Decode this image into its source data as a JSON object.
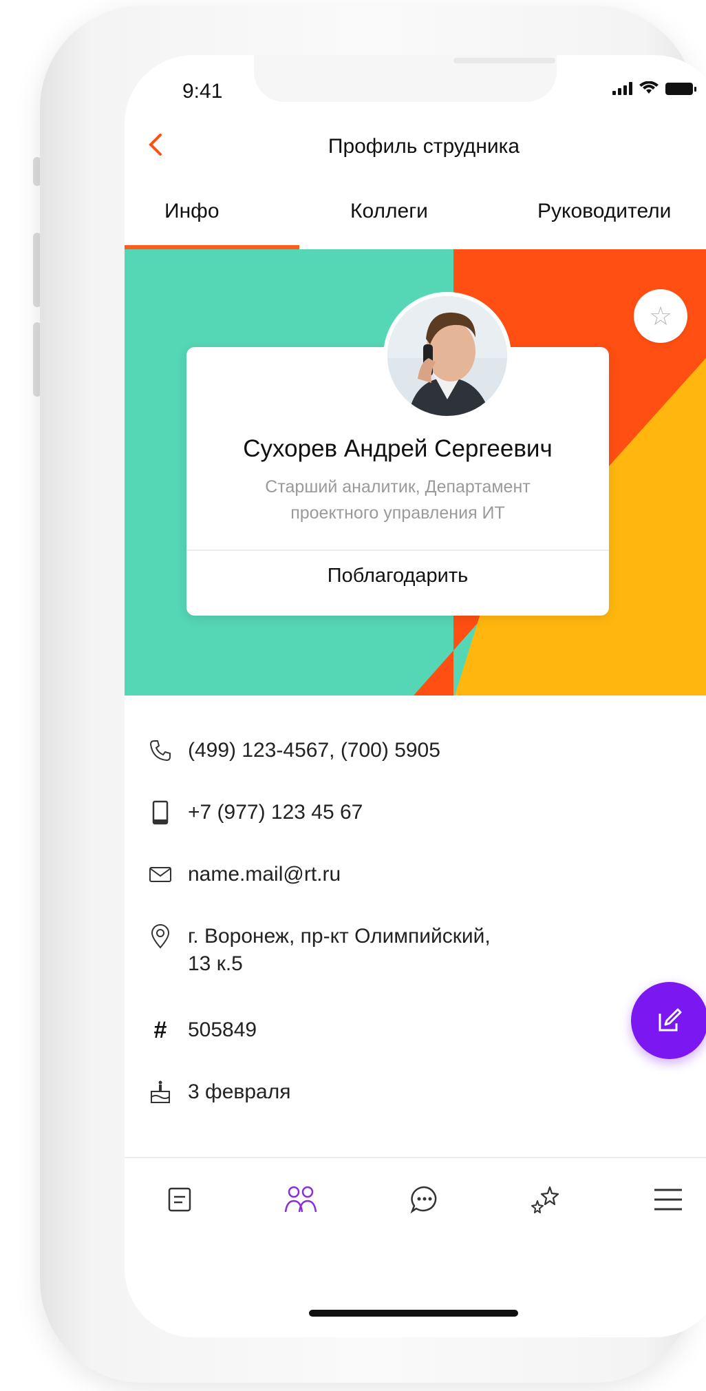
{
  "status_bar": {
    "time": "9:41"
  },
  "header": {
    "title": "Профиль струдника"
  },
  "tabs": [
    {
      "label": "Инфо",
      "active": true
    },
    {
      "label": "Коллеги",
      "active": false
    },
    {
      "label": "Руководители",
      "active": false
    }
  ],
  "colors": {
    "accent": "#ff5c1e",
    "banner_teal": "#55d6b4",
    "banner_orange": "#ff4f12",
    "banner_yellow": "#ffb70f",
    "fab_purple": "#7b18f2",
    "active_tab_icon": "#8a2be2"
  },
  "profile": {
    "name": "Сухорев Андрей Сергеевич",
    "position_line1": "Старший аналитик, Департамент",
    "position_line2": "проектного управления ИТ",
    "thank_label": "Поблагодарить",
    "favorite_icon": "star-icon"
  },
  "details": {
    "phones": "(499) 123-4567, (700) 5905",
    "mobile": "+7 (977) 123 45 67",
    "email": "name.mail@rt.ru",
    "address_line1": "г. Воронеж, пр-кт Олимпийский,",
    "address_line2": "13 к.5",
    "id": "505849",
    "birthday": "3 февраля"
  },
  "icons": {
    "phone": "phone-icon",
    "mobile": "mobile-icon",
    "mail": "mail-icon",
    "location": "location-icon",
    "hash": "hash-icon",
    "cake": "cake-icon",
    "fab": "edit-icon"
  },
  "tabbar": [
    {
      "icon": "news-icon",
      "active": false
    },
    {
      "icon": "people-icon",
      "active": true
    },
    {
      "icon": "chat-icon",
      "active": false
    },
    {
      "icon": "stars-icon",
      "active": false
    },
    {
      "icon": "menu-icon",
      "active": false
    }
  ]
}
